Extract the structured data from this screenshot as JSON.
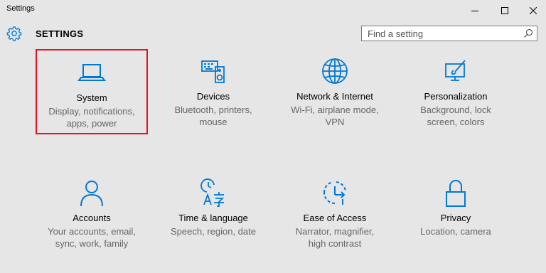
{
  "window": {
    "title": "Settings",
    "minimize_icon": "minimize-icon",
    "maximize_icon": "maximize-icon",
    "close_icon": "close-icon"
  },
  "header": {
    "title": "SETTINGS",
    "icon": "gear-icon"
  },
  "search": {
    "placeholder": "Find a setting",
    "icon": "search-icon"
  },
  "accent_color": "#0078d7",
  "highlight_color": "#e81123",
  "tiles": [
    {
      "label": "System",
      "desc1": "Display, notifications,",
      "desc2": "apps, power",
      "icon": "laptop-icon",
      "selected": true
    },
    {
      "label": "Devices",
      "desc1": "Bluetooth, printers,",
      "desc2": "mouse",
      "icon": "devices-icon"
    },
    {
      "label": "Network & Internet",
      "desc1": "Wi-Fi, airplane mode,",
      "desc2": "VPN",
      "icon": "globe-icon"
    },
    {
      "label": "Personalization",
      "desc1": "Background, lock",
      "desc2": "screen, colors",
      "icon": "personalization-icon"
    },
    {
      "label": "Accounts",
      "desc1": "Your accounts, email,",
      "desc2": "sync, work, family",
      "icon": "person-icon"
    },
    {
      "label": "Time & language",
      "desc1": "Speech, region, date",
      "desc2": "",
      "icon": "time-language-icon"
    },
    {
      "label": "Ease of Access",
      "desc1": "Narrator, magnifier,",
      "desc2": "high contrast",
      "icon": "ease-of-access-icon"
    },
    {
      "label": "Privacy",
      "desc1": "Location, camera",
      "desc2": "",
      "icon": "lock-icon"
    }
  ]
}
